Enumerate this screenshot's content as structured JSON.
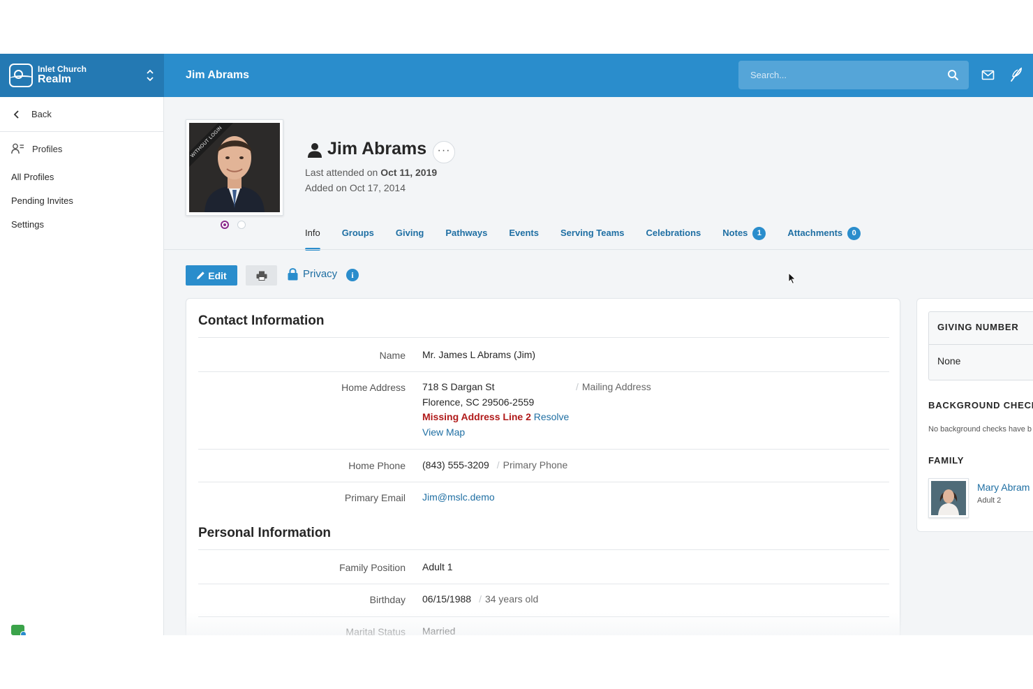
{
  "brand": {
    "org": "Inlet Church",
    "app_name": "Realm"
  },
  "header": {
    "title": "Jim Abrams",
    "search_placeholder": "Search..."
  },
  "sidebar": {
    "back_label": "Back",
    "section_label": "Profiles",
    "links": [
      "All Profiles",
      "Pending Invites",
      "Settings"
    ]
  },
  "profile": {
    "photo_ribbon": "WITHOUT LOGIN",
    "name": "Jim Abrams",
    "last_attended_prefix": "Last attended on",
    "last_attended_date": "Oct 11, 2019",
    "added": "Added on Oct 17, 2014"
  },
  "tabs": [
    {
      "label": "Info",
      "active": true
    },
    {
      "label": "Groups"
    },
    {
      "label": "Giving"
    },
    {
      "label": "Pathways"
    },
    {
      "label": "Events"
    },
    {
      "label": "Serving Teams"
    },
    {
      "label": "Celebrations"
    },
    {
      "label": "Notes",
      "badge": "1"
    },
    {
      "label": "Attachments",
      "badge": "0"
    }
  ],
  "toolbar": {
    "edit_label": "Edit",
    "privacy_label": "Privacy",
    "info_glyph": "i"
  },
  "contact": {
    "title": "Contact Information",
    "name_label": "Name",
    "name_value": "Mr. James L Abrams (Jim)",
    "address_label": "Home Address",
    "address_line1": "718 S Dargan St",
    "address_line2": "Florence, SC 29506-2559",
    "address_tag": "Mailing Address",
    "address_warning": "Missing Address Line 2",
    "resolve_link": "Resolve",
    "map_link": "View Map",
    "phone_label": "Home Phone",
    "phone_value": "(843) 555-3209",
    "phone_tag": "Primary Phone",
    "email_label": "Primary Email",
    "email_value": "Jim@mslc.demo"
  },
  "personal": {
    "title": "Personal Information",
    "family_position_label": "Family Position",
    "family_position_value": "Adult 1",
    "birthday_label": "Birthday",
    "birthday_value": "06/15/1988",
    "age_tag": "34 years old",
    "marital_label": "Marital Status",
    "marital_value": "Married"
  },
  "side_panel": {
    "giving_title": "GIVING NUMBER",
    "giving_value": "None",
    "background_title": "BACKGROUND CHECK",
    "background_note": "No background checks have b",
    "family_title": "FAMILY",
    "family_member_name": "Mary Abram",
    "family_member_position": "Adult 2"
  },
  "colors": {
    "primary": "#2a8dcc",
    "brand_dark": "#2479b3",
    "link": "#1f6fa3",
    "warning": "#b01a1a",
    "carousel_active": "#8b2a8c"
  },
  "icons": [
    "search-icon",
    "mail-icon",
    "feather-icon",
    "chevron-left-icon",
    "profiles-icon",
    "person-icon",
    "more-icon",
    "pencil-icon",
    "print-icon",
    "lock-icon",
    "info-icon"
  ]
}
